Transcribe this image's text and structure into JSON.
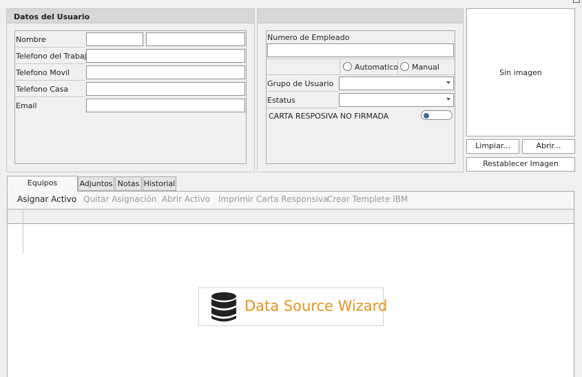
{
  "user_panel": {
    "title": "Datos del Usuario",
    "fields": {
      "nombre": "Nombre",
      "tel_trabajo": "Telefono del Trabajo",
      "tel_movil": "Telefono Movil",
      "tel_casa": "Telefono Casa",
      "email": "Email"
    },
    "values": {
      "nombre_first": "",
      "nombre_last": "",
      "tel_trabajo": "",
      "tel_movil": "",
      "tel_casa": "",
      "email": ""
    }
  },
  "employee_panel": {
    "num_empleado_label": "Numero de Empleado",
    "num_empleado_value": "",
    "radio_auto": "Automatico",
    "radio_manual": "Manual",
    "grupo_label": "Grupo de Usuario",
    "grupo_value": "",
    "estatus_label": "Estatus",
    "estatus_value": "",
    "carta_label": "CARTA RESPOSIVA NO FIRMADA",
    "carta_toggle_on": false
  },
  "image_panel": {
    "placeholder": "Sin imagen",
    "clear_label": "Limpiar...",
    "open_label": "Abrir...",
    "reset_label": "Restablecer Imagen"
  },
  "tabs": [
    "Equipos Asignados",
    "Adjuntos",
    "Notas",
    "Historial"
  ],
  "toolbar": {
    "assign": "Asignar Activo",
    "remove": "Quitar Asignación",
    "open": "Abrir Activo",
    "print": "Imprimir Carta Responsiva",
    "create": "Crear Templete IBM"
  },
  "wizard": {
    "label": "Data Source Wizard",
    "color": "#e8901a",
    "icon": "database-icon"
  }
}
